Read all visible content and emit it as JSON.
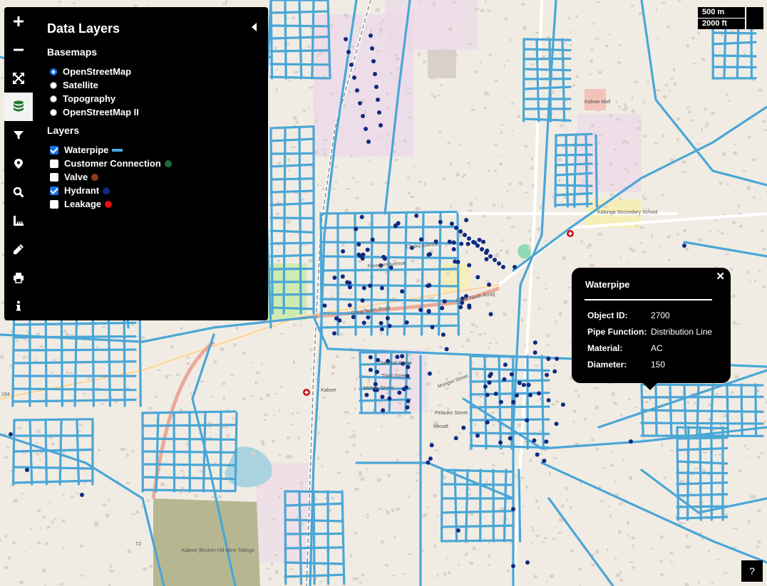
{
  "panel": {
    "title": "Data Layers",
    "basemaps_heading": "Basemaps",
    "basemaps": [
      {
        "label": "OpenStreetMap",
        "selected": true
      },
      {
        "label": "Satellite",
        "selected": false
      },
      {
        "label": "Topography",
        "selected": false
      },
      {
        "label": "OpenStreetMap II",
        "selected": false
      }
    ],
    "layers_heading": "Layers",
    "layers": [
      {
        "label": "Waterpipe",
        "checked": true,
        "legend": "line",
        "color": "#4aa6d6"
      },
      {
        "label": "Customer Connection",
        "checked": false,
        "legend": "dot",
        "color": "#1e6b3a"
      },
      {
        "label": "Valve",
        "checked": false,
        "legend": "dot",
        "color": "#8b3a1a"
      },
      {
        "label": "Hydrant",
        "checked": true,
        "legend": "dot",
        "color": "#0f2a80"
      },
      {
        "label": "Leakage",
        "checked": false,
        "legend": "dot",
        "color": "#e01010"
      }
    ]
  },
  "toolbar": {
    "tools": [
      "zoom-in-icon",
      "zoom-out-icon",
      "fullscreen-icon",
      "layers-icon",
      "filter-icon",
      "marker-icon",
      "search-icon",
      "measure-icon",
      "draw-icon",
      "print-icon",
      "info-icon"
    ],
    "active": "layers-icon"
  },
  "scale": {
    "metric": "500 m",
    "imperial": "2000 ft"
  },
  "popup": {
    "title": "Waterpipe",
    "close": "✕",
    "rows": [
      {
        "key": "Object ID:",
        "value": "2700"
      },
      {
        "key": "Pipe Function:",
        "value": "Distribution Line"
      },
      {
        "key": "Material:",
        "value": "AC"
      },
      {
        "key": "Diameter:",
        "value": "150"
      }
    ]
  },
  "map_labels": {
    "kabwe_mall": "Kabwe Mall",
    "kalonga_school": "Kalonga Secondary School",
    "great_north_road": "Great North Road",
    "great_north_road_2": "Great North Road",
    "kabwe": "Kabwe",
    "tailings": "Kabwe (Broken Hill Mine Tailings",
    "route_t2": "T2",
    "route_194": "194",
    "chaka_avenue": "Chaka Avenue",
    "second_street": "Second Street",
    "third_street": "Third Street",
    "munda_street": "Munda Street",
    "mungwi_street": "Mungwi Street",
    "pelauke_street": "Pelauke Street",
    "mesaft": "Mesaft",
    "freedom_avenue": "Freedom Avenue"
  },
  "colors": {
    "pipe": "#4aa6d6",
    "hydrant": "#0f2a80",
    "map_bg": "#f0ece4"
  },
  "help": "?"
}
